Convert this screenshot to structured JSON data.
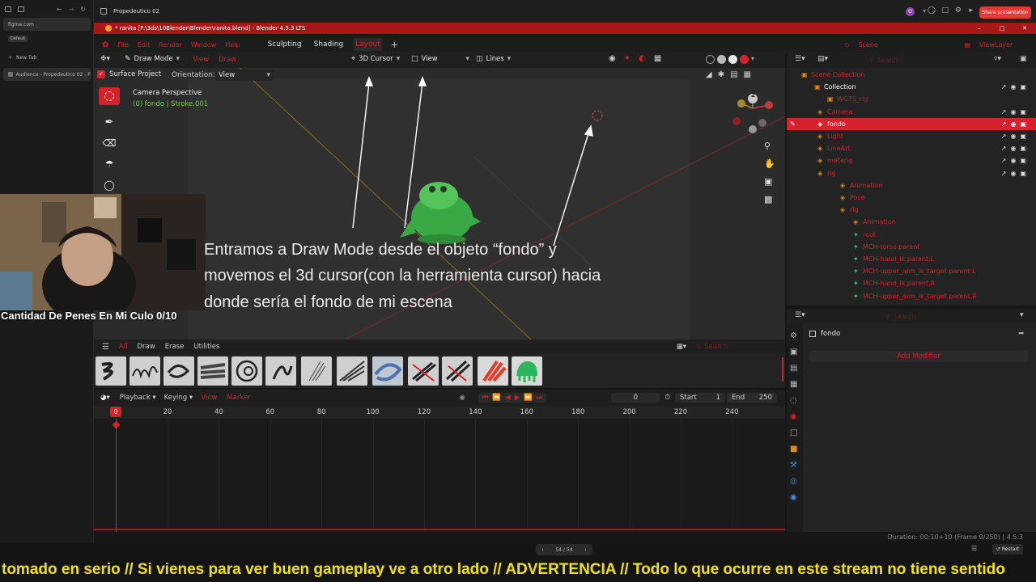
{
  "browser": {
    "url": "figma.com",
    "default_label": "Default",
    "new_tab": "New Tab",
    "active_tab": "Audience - Propedeutico 02 - Fi..."
  },
  "figma": {
    "file_title": "Propedeutico 02",
    "share_label": "Share presentation",
    "slide_counter": "54 / 54",
    "restart_label": "Restart"
  },
  "blender": {
    "window_title": "* ranita [F:\\3ds\\10Blender\\Blender\\ranita.blend] - Blender 4.5.3 LTS",
    "menu": [
      "File",
      "Edit",
      "Render",
      "Window",
      "Help"
    ],
    "workspaces": [
      "Sculpting",
      "Shading",
      "Layout"
    ],
    "active_workspace": "Layout",
    "scene_name": "Scene",
    "view_layer": "ViewLayer",
    "viewport": {
      "mode": "Draw Mode",
      "view_menu": "View",
      "draw_menu": "Draw",
      "cursor_dropdown": "3D Cursor",
      "view_dropdown": "View",
      "lines_dropdown": "Lines",
      "surface_project": "Surface Project",
      "orientation_label": "Orientation:",
      "orientation_value": "View",
      "camera_title": "Camera Perspective",
      "camera_sub": "(0) fondo | Stroke.001",
      "gizmo_z": "Z"
    },
    "caption": [
      "Entramos a Draw Mode desde el objeto “fondo” y",
      "movemos el 3d cursor(con la herramienta cursor) hacia",
      "donde sería el fondo de mi escena"
    ],
    "brush_tabs": [
      "All",
      "Draw",
      "Erase",
      "Utilities"
    ],
    "brush_search_placeholder": "Search",
    "timeline": {
      "playback": "Playback",
      "keying": "Keying",
      "view": "View",
      "marker": "Marker",
      "current_frame": "0",
      "start_label": "Start",
      "start_value": "1",
      "end_label": "End",
      "end_value": "250",
      "playhead": "0",
      "ruler_ticks": [
        "20",
        "40",
        "60",
        "80",
        "100",
        "120",
        "140",
        "160",
        "180",
        "200",
        "220",
        "240"
      ]
    },
    "status": "Duration: 00:10+10 (Frame 0/250) | 4.5.3",
    "outliner": {
      "search_placeholder": "Search",
      "rows": [
        {
          "label": "Scene Collection",
          "color": "red"
        },
        {
          "label": "Collection",
          "color": "white"
        },
        {
          "label": "WGTS_rig",
          "color": "dim"
        },
        {
          "label": "Camera",
          "color": "red"
        },
        {
          "label": "fondo",
          "color": "white"
        },
        {
          "label": "Light",
          "color": "red"
        },
        {
          "label": "LineArt",
          "color": "red"
        },
        {
          "label": "metarig",
          "color": "red"
        },
        {
          "label": "rig",
          "color": "red"
        },
        {
          "label": "Animation",
          "color": "red"
        },
        {
          "label": "Pose",
          "color": "red"
        },
        {
          "label": "rig",
          "color": "red"
        },
        {
          "label": "Animation",
          "color": "red"
        },
        {
          "label": "root",
          "color": "red"
        },
        {
          "label": "MCH-torso.parent",
          "color": "red"
        },
        {
          "label": "MCH-hand_ik.parent.L",
          "color": "red"
        },
        {
          "label": "MCH-upper_arm_ik_target.parent.L",
          "color": "red"
        },
        {
          "label": "MCH-hand_ik.parent.R",
          "color": "red"
        },
        {
          "label": "MCH-upper_arm_ik_target.parent.R",
          "color": "red"
        }
      ]
    },
    "properties": {
      "search_placeholder": "Search",
      "object_name": "fondo",
      "add_modifier": "Add Modifier"
    }
  },
  "webcam": {
    "overlay_text": "Cantidad De Penes En Mi Culo 0/10"
  },
  "ticker": {
    "text": "tomado en serio // Si vienes para ver buen gameplay ve a otro lado //  ADVERTENCIA // Todo lo que ocurre en este stream no tiene sentido"
  },
  "colors": {
    "accent_red": "#d2232a",
    "title_red": "#a61818",
    "ticker_yellow": "#f0e30c",
    "frog_green": "#3aa845"
  }
}
